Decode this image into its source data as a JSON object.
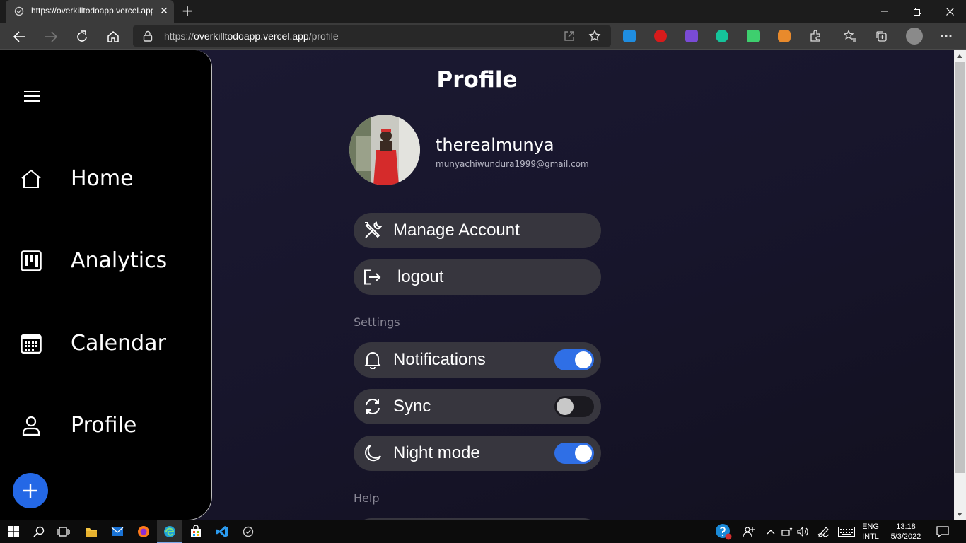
{
  "browser": {
    "tab_title": "https://overkilltodoapp.vercel.app/profile",
    "url_scheme": "https://",
    "url_host": "overkilltodoapp.vercel.app",
    "url_path": "/profile",
    "tab_close": "✕",
    "new_tab": "+"
  },
  "sidebar": {
    "items": [
      {
        "label": "Home",
        "icon": "home-icon"
      },
      {
        "label": "Analytics",
        "icon": "analytics-icon"
      },
      {
        "label": "Calendar",
        "icon": "calendar-icon"
      },
      {
        "label": "Profile",
        "icon": "person-icon"
      }
    ]
  },
  "main": {
    "title": "Profile",
    "user": {
      "name": "therealmunya",
      "email": "munyachiwundura1999@gmail.com"
    },
    "actions": [
      {
        "label": "Manage Account",
        "icon": "tools-icon"
      },
      {
        "label": "logout",
        "icon": "logout-icon"
      }
    ],
    "settings_heading": "Settings",
    "settings": [
      {
        "label": "Notifications",
        "icon": "bell-icon",
        "enabled": true
      },
      {
        "label": "Sync",
        "icon": "sync-icon",
        "enabled": false
      },
      {
        "label": "Night mode",
        "icon": "moon-icon",
        "enabled": true
      }
    ],
    "help_heading": "Help"
  },
  "colors": {
    "accent": "#2f6fe6",
    "fab": "#2468e6",
    "pill": "#37363e",
    "sidebar": "#000000"
  },
  "taskbar": {
    "lang_top": "ENG",
    "lang_bottom": "INTL",
    "time": "13:18",
    "date": "5/3/2022"
  }
}
